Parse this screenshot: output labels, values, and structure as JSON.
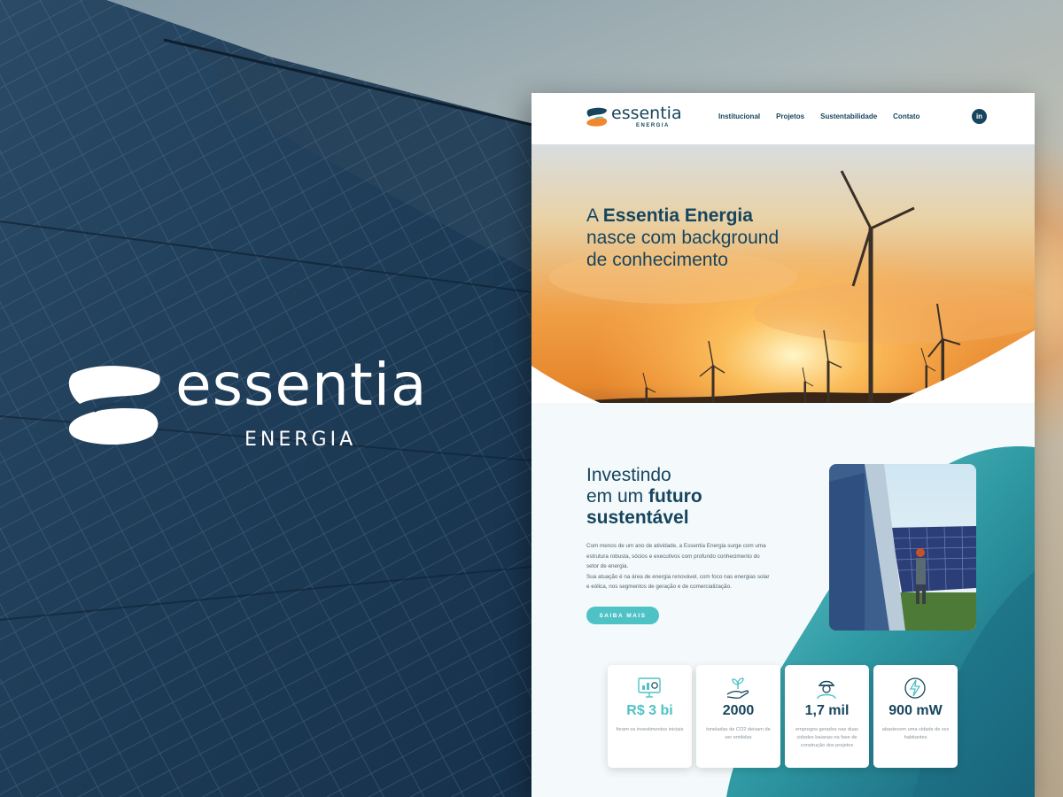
{
  "brand": {
    "name": "essentia",
    "sub": "ENERGIA"
  },
  "colors": {
    "navy": "#17455e",
    "teal": "#4fc2c6",
    "deep_teal": "#1e6f80",
    "panel_blue": "#1d3a52"
  },
  "nav": {
    "logo_name": "essentia",
    "logo_sub": "ENERGIA",
    "items": [
      "Institucional",
      "Projetos",
      "Sustentabilidade",
      "Contato"
    ],
    "social_icon": "linkedin-icon",
    "social_label": "in"
  },
  "hero": {
    "title_strong": "Essentia Energia",
    "title_prefix": "A ",
    "title_rest_1": "nasce com background",
    "title_rest_2": "de conhecimento"
  },
  "section": {
    "title_line1": "Investindo",
    "title_line2_prefix": "em um ",
    "title_line2_strong": "futuro",
    "title_line3": "sustentável",
    "body": [
      "Com menos de um ano de atividade, a Essentia Energia surge com uma estrutura robusta, sócios e executivos com profundo conhecimento do setor de energia.",
      "Sua atuação é na área de energia renovável, com foco nas energias solar e eólica, nos segmentos de geração e de comercialização."
    ],
    "cta": "SAIBA MAIS"
  },
  "stats": [
    {
      "icon": "monitor-chart-icon",
      "value": "R$ 3 bi",
      "color": "#4fc2c6",
      "desc": "foram os investimentos iniciais"
    },
    {
      "icon": "hand-plant-icon",
      "value": "2000",
      "color": "#17455e",
      "desc": "toneladas de CO2 deixam de ser emitidas"
    },
    {
      "icon": "worker-icon",
      "value": "1,7 mil",
      "color": "#17455e",
      "desc": "empregos gerados nas duas cidades baianas na fase de construção dos projetos"
    },
    {
      "icon": "lightning-icon",
      "value": "900 mW",
      "color": "#17455e",
      "desc": "abastecem uma cidade de xxx habitantes"
    }
  ]
}
